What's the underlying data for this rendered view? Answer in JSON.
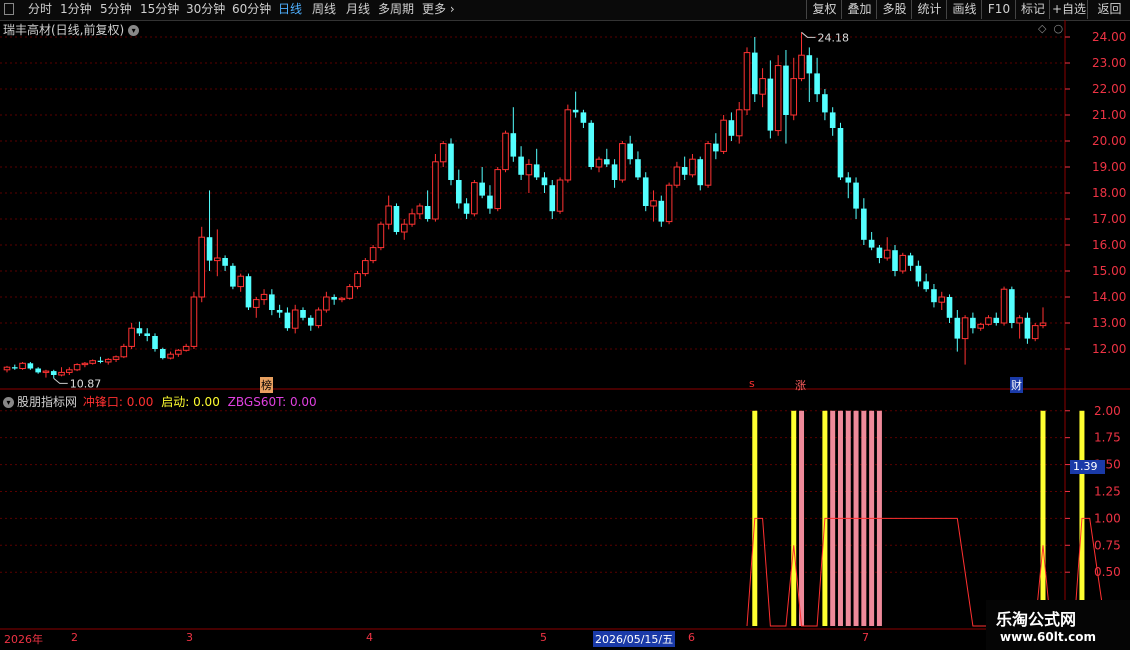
{
  "toolbar": {
    "periods": [
      "分时",
      "1分钟",
      "5分钟",
      "15分钟",
      "30分钟",
      "60分钟",
      "日线",
      "周线",
      "月线",
      "多周期",
      "更多"
    ],
    "active_period": "日线",
    "right_buttons": [
      "复权",
      "叠加",
      "多股",
      "统计",
      "画线",
      "F10",
      "标记",
      "+自选",
      "返回"
    ]
  },
  "main_pane": {
    "title": "瑞丰高材(日线,前复权)",
    "high_label": "24.18",
    "low_label": "10.87",
    "markers": {
      "bang": "榜",
      "s": "s",
      "zhang": "涨",
      "cai": "财"
    },
    "y_ticks": [
      "24.00",
      "23.00",
      "22.00",
      "21.00",
      "20.00",
      "19.00",
      "18.00",
      "17.00",
      "16.00",
      "15.00",
      "14.00",
      "13.00",
      "12.00"
    ]
  },
  "indicator_pane": {
    "name": "股朋指标网",
    "vals": [
      {
        "label": "冲锋口: 0.00",
        "color": "#ff3030"
      },
      {
        "label": "启动: 0.00",
        "color": "#ffff30"
      },
      {
        "label": "ZBGS60T: 0.00",
        "color": "#e040e0"
      }
    ],
    "y_ticks": [
      "2.00",
      "1.75",
      "1.50",
      "1.25",
      "1.00",
      "0.75",
      "0.50"
    ],
    "current_value": "1.39"
  },
  "date_axis": {
    "labels": [
      "2026年",
      "2",
      "3",
      "4",
      "5",
      "6",
      "7"
    ],
    "selected_date": "2026/05/15/五"
  },
  "watermark": {
    "line1": "乐淘公式网",
    "line2": "www.60lt.com"
  },
  "colors": {
    "up": "#ff3232",
    "down": "#54ffff",
    "grid": "#5a0000",
    "yellow": "#ffff30",
    "pink": "#ef8a9a"
  },
  "chart_data": {
    "type": "candlestick",
    "candles": [
      [
        11.2,
        11.35,
        11.1,
        11.3
      ],
      [
        11.3,
        11.4,
        11.2,
        11.25
      ],
      [
        11.25,
        11.5,
        11.2,
        11.45
      ],
      [
        11.45,
        11.5,
        11.2,
        11.25
      ],
      [
        11.25,
        11.3,
        11.05,
        11.1
      ],
      [
        11.1,
        11.2,
        10.9,
        11.15
      ],
      [
        11.15,
        11.2,
        10.87,
        11.0
      ],
      [
        11.0,
        11.3,
        10.95,
        11.1
      ],
      [
        11.1,
        11.3,
        11.0,
        11.2
      ],
      [
        11.2,
        11.45,
        11.15,
        11.4
      ],
      [
        11.4,
        11.5,
        11.3,
        11.45
      ],
      [
        11.45,
        11.6,
        11.4,
        11.55
      ],
      [
        11.55,
        11.7,
        11.45,
        11.5
      ],
      [
        11.5,
        11.65,
        11.4,
        11.6
      ],
      [
        11.6,
        11.75,
        11.5,
        11.7
      ],
      [
        11.7,
        12.2,
        11.65,
        12.1
      ],
      [
        12.1,
        13.0,
        12.0,
        12.8
      ],
      [
        12.8,
        13.05,
        12.5,
        12.6
      ],
      [
        12.6,
        12.8,
        12.3,
        12.5
      ],
      [
        12.5,
        12.6,
        11.9,
        12.0
      ],
      [
        12.0,
        12.05,
        11.6,
        11.65
      ],
      [
        11.65,
        11.9,
        11.6,
        11.8
      ],
      [
        11.8,
        12.0,
        11.7,
        11.95
      ],
      [
        11.95,
        12.2,
        11.9,
        12.1
      ],
      [
        12.1,
        14.2,
        12.0,
        14.0
      ],
      [
        14.0,
        16.7,
        13.8,
        16.3
      ],
      [
        16.3,
        18.1,
        15.0,
        15.4
      ],
      [
        15.4,
        16.6,
        14.8,
        15.5
      ],
      [
        15.5,
        15.6,
        15.0,
        15.2
      ],
      [
        15.2,
        15.3,
        14.3,
        14.4
      ],
      [
        14.4,
        14.9,
        14.2,
        14.8
      ],
      [
        14.8,
        14.9,
        13.5,
        13.6
      ],
      [
        13.6,
        14.0,
        13.2,
        13.9
      ],
      [
        13.9,
        14.3,
        13.7,
        14.1
      ],
      [
        14.1,
        14.3,
        13.3,
        13.5
      ],
      [
        13.5,
        13.7,
        13.2,
        13.4
      ],
      [
        13.4,
        13.6,
        12.7,
        12.8
      ],
      [
        12.8,
        13.7,
        12.6,
        13.5
      ],
      [
        13.5,
        13.6,
        13.1,
        13.2
      ],
      [
        13.2,
        13.3,
        12.7,
        12.9
      ],
      [
        12.9,
        13.6,
        12.8,
        13.5
      ],
      [
        13.5,
        14.2,
        13.4,
        14.0
      ],
      [
        14.0,
        14.1,
        13.7,
        13.9
      ],
      [
        13.9,
        14.0,
        13.8,
        13.95
      ],
      [
        13.95,
        14.5,
        13.9,
        14.4
      ],
      [
        14.4,
        15.0,
        14.3,
        14.9
      ],
      [
        14.9,
        15.5,
        14.8,
        15.4
      ],
      [
        15.4,
        16.0,
        15.3,
        15.9
      ],
      [
        15.9,
        16.9,
        15.8,
        16.8
      ],
      [
        16.8,
        17.9,
        16.6,
        17.5
      ],
      [
        17.5,
        17.6,
        16.4,
        16.5
      ],
      [
        16.5,
        17.0,
        16.2,
        16.8
      ],
      [
        16.8,
        17.4,
        16.7,
        17.2
      ],
      [
        17.2,
        17.6,
        17.0,
        17.5
      ],
      [
        17.5,
        18.1,
        16.9,
        17.0
      ],
      [
        17.0,
        19.5,
        16.9,
        19.2
      ],
      [
        19.2,
        20.0,
        19.0,
        19.9
      ],
      [
        19.9,
        20.1,
        18.3,
        18.5
      ],
      [
        18.5,
        18.9,
        17.4,
        17.6
      ],
      [
        17.6,
        17.8,
        17.0,
        17.2
      ],
      [
        17.2,
        18.5,
        17.1,
        18.4
      ],
      [
        18.4,
        19.0,
        17.8,
        17.9
      ],
      [
        17.9,
        18.3,
        17.2,
        17.4
      ],
      [
        17.4,
        19.0,
        17.3,
        18.9
      ],
      [
        18.9,
        20.4,
        18.8,
        20.3
      ],
      [
        20.3,
        21.3,
        19.2,
        19.4
      ],
      [
        19.4,
        19.8,
        18.5,
        18.7
      ],
      [
        18.7,
        19.3,
        18.0,
        19.1
      ],
      [
        19.1,
        19.7,
        18.5,
        18.6
      ],
      [
        18.6,
        18.8,
        18.0,
        18.3
      ],
      [
        18.3,
        18.5,
        17.0,
        17.3
      ],
      [
        17.3,
        18.6,
        17.2,
        18.5
      ],
      [
        18.5,
        21.4,
        18.4,
        21.2
      ],
      [
        21.2,
        21.9,
        20.9,
        21.1
      ],
      [
        21.1,
        21.2,
        20.5,
        20.7
      ],
      [
        20.7,
        20.8,
        18.9,
        19.0
      ],
      [
        19.0,
        19.4,
        18.8,
        19.3
      ],
      [
        19.3,
        19.7,
        19.0,
        19.1
      ],
      [
        19.1,
        19.3,
        18.2,
        18.5
      ],
      [
        18.5,
        20.0,
        18.4,
        19.9
      ],
      [
        19.9,
        20.2,
        19.1,
        19.3
      ],
      [
        19.3,
        19.6,
        18.5,
        18.6
      ],
      [
        18.6,
        18.8,
        17.3,
        17.5
      ],
      [
        17.5,
        18.1,
        16.9,
        17.7
      ],
      [
        17.7,
        17.9,
        16.7,
        16.9
      ],
      [
        16.9,
        18.4,
        16.8,
        18.3
      ],
      [
        18.3,
        19.2,
        18.2,
        19.0
      ],
      [
        19.0,
        19.4,
        18.5,
        18.7
      ],
      [
        18.7,
        19.5,
        18.6,
        19.3
      ],
      [
        19.3,
        19.4,
        18.1,
        18.3
      ],
      [
        18.3,
        20.0,
        18.2,
        19.9
      ],
      [
        19.9,
        20.3,
        19.3,
        19.6
      ],
      [
        19.6,
        21.0,
        19.5,
        20.8
      ],
      [
        20.8,
        21.1,
        20.0,
        20.2
      ],
      [
        20.2,
        21.5,
        19.9,
        21.2
      ],
      [
        21.2,
        23.6,
        21.0,
        23.4
      ],
      [
        23.4,
        24.0,
        21.5,
        21.8
      ],
      [
        21.8,
        22.8,
        21.3,
        22.4
      ],
      [
        22.4,
        23.1,
        20.1,
        20.4
      ],
      [
        20.4,
        23.3,
        20.2,
        22.9
      ],
      [
        22.9,
        23.5,
        19.9,
        21.0
      ],
      [
        21.0,
        23.2,
        20.8,
        22.4
      ],
      [
        22.4,
        24.18,
        22.3,
        23.3
      ],
      [
        23.3,
        23.6,
        21.5,
        22.6
      ],
      [
        22.6,
        23.2,
        21.5,
        21.8
      ],
      [
        21.8,
        22.0,
        20.8,
        21.1
      ],
      [
        21.1,
        21.3,
        20.2,
        20.5
      ],
      [
        20.5,
        20.7,
        18.5,
        18.6
      ],
      [
        18.6,
        18.8,
        17.8,
        18.4
      ],
      [
        18.4,
        18.6,
        17.0,
        17.4
      ],
      [
        17.4,
        17.8,
        16.0,
        16.2
      ],
      [
        16.2,
        16.5,
        15.8,
        15.9
      ],
      [
        15.9,
        16.0,
        15.3,
        15.5
      ],
      [
        15.5,
        16.3,
        15.4,
        15.8
      ],
      [
        15.8,
        16.0,
        14.8,
        15.0
      ],
      [
        15.0,
        15.7,
        14.9,
        15.6
      ],
      [
        15.6,
        15.7,
        15.0,
        15.2
      ],
      [
        15.2,
        15.4,
        14.4,
        14.6
      ],
      [
        14.6,
        14.9,
        14.2,
        14.3
      ],
      [
        14.3,
        14.5,
        13.6,
        13.8
      ],
      [
        13.8,
        14.2,
        13.5,
        14.0
      ],
      [
        14.0,
        14.1,
        13.0,
        13.2
      ],
      [
        13.2,
        13.5,
        11.9,
        12.4
      ],
      [
        12.4,
        13.3,
        11.4,
        13.2
      ],
      [
        13.2,
        13.4,
        12.6,
        12.8
      ],
      [
        12.8,
        13.0,
        12.7,
        12.95
      ],
      [
        12.95,
        13.3,
        12.9,
        13.2
      ],
      [
        13.2,
        13.4,
        12.9,
        13.0
      ],
      [
        13.0,
        14.4,
        12.9,
        14.3
      ],
      [
        14.3,
        14.4,
        12.8,
        13.0
      ],
      [
        13.0,
        13.3,
        12.4,
        13.2
      ],
      [
        13.2,
        13.4,
        12.2,
        12.4
      ],
      [
        12.4,
        13.0,
        12.3,
        12.9
      ],
      [
        12.9,
        13.6,
        12.8,
        13.0
      ]
    ],
    "indicator_yellow_bars": [
      96,
      101,
      105,
      133,
      138
    ],
    "indicator_pink_bars": [
      102,
      106,
      107,
      108,
      109,
      110,
      111,
      112
    ],
    "indicator_line": [
      [
        95,
        0
      ],
      [
        96,
        1
      ],
      [
        97,
        1
      ],
      [
        98,
        0
      ],
      [
        100,
        0
      ],
      [
        101,
        0.75
      ],
      [
        102,
        0
      ],
      [
        104,
        0
      ],
      [
        105,
        1
      ],
      [
        106,
        1
      ],
      [
        112,
        1
      ],
      [
        122,
        1
      ],
      [
        124,
        0
      ],
      [
        132,
        0
      ],
      [
        133,
        0.75
      ],
      [
        134,
        0
      ],
      [
        137,
        0
      ],
      [
        138,
        1
      ],
      [
        139,
        1
      ],
      [
        141,
        0
      ]
    ],
    "ylim_main": [
      11.0,
      24.5
    ],
    "ylim_indicator": [
      0.0,
      2.1
    ]
  }
}
